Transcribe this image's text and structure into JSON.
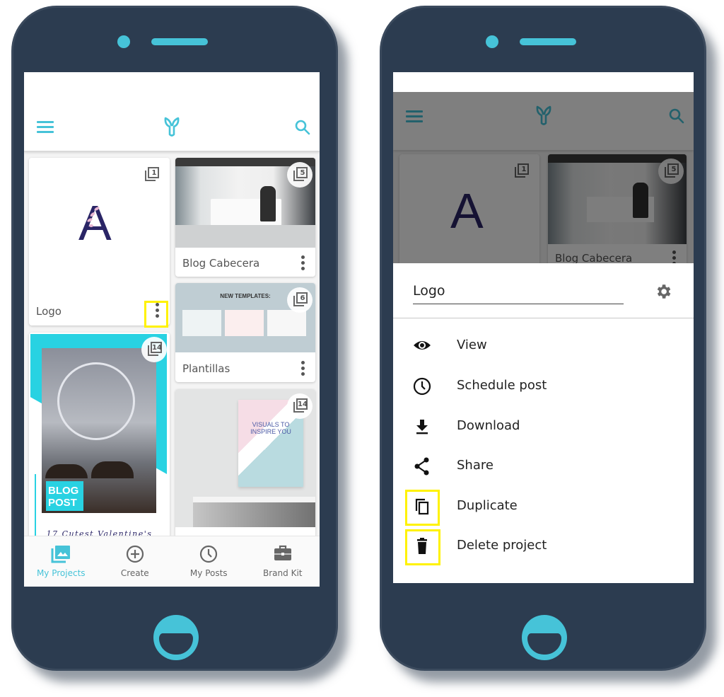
{
  "colors": {
    "accent": "#46c3d8",
    "phone_body": "#2c3c50",
    "highlight": "#fff200"
  },
  "left_screen": {
    "appbar": {
      "menu_icon": "hamburger-menu-icon",
      "logo_icon": "app-logo-icon",
      "search_icon": "search-icon"
    },
    "projects": [
      {
        "title": "Logo",
        "pages": "1",
        "thumbnail_text": "A"
      },
      {
        "title": "Blog Cabecera",
        "pages": "5"
      },
      {
        "title": "Plantillas",
        "pages": "6",
        "thumbnail_text": "NEW TEMPLATES:"
      },
      {
        "title": "",
        "pages": "14",
        "thumbnail_text": "BLOG POST",
        "thumbnail_caption": "17 Cutest Valentine's"
      },
      {
        "title": "",
        "pages": "14",
        "thumbnail_text": "VISUALS TO INSPIRE YOU"
      }
    ],
    "bottom_nav": [
      {
        "label": "My Projects",
        "icon": "photo-library-icon",
        "active": true
      },
      {
        "label": "Create",
        "icon": "add-circle-icon",
        "active": false
      },
      {
        "label": "My Posts",
        "icon": "clock-icon",
        "active": false
      },
      {
        "label": "Brand Kit",
        "icon": "briefcase-icon",
        "active": false
      }
    ]
  },
  "right_screen": {
    "background_projects": [
      {
        "title": "",
        "pages": "1",
        "thumbnail_text": "A"
      },
      {
        "title": "Blog Cabecera",
        "pages": "5"
      }
    ],
    "sheet": {
      "project_name": "Logo",
      "settings_icon": "gear-icon",
      "actions": [
        {
          "label": "View",
          "icon": "eye-icon"
        },
        {
          "label": "Schedule post",
          "icon": "clock-icon"
        },
        {
          "label": "Download",
          "icon": "download-icon"
        },
        {
          "label": "Share",
          "icon": "share-icon"
        },
        {
          "label": "Duplicate",
          "icon": "duplicate-icon"
        },
        {
          "label": "Delete project",
          "icon": "trash-icon"
        }
      ]
    }
  }
}
